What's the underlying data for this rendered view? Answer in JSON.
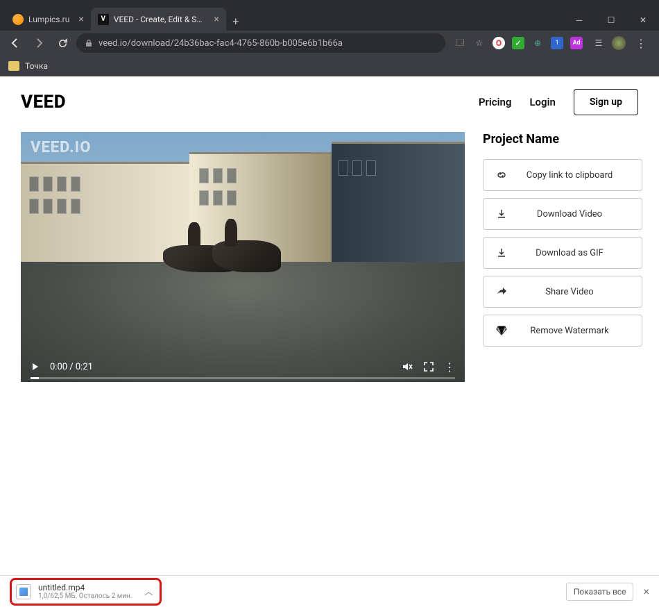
{
  "window": {
    "tabs": [
      {
        "title": "Lumpics.ru"
      },
      {
        "title": "VEED - Create, Edit & Share Vide"
      }
    ]
  },
  "addressbar": {
    "url": "veed.io/download/24b36bac-fac4-4765-860b-b005e6b1b66a"
  },
  "bookmarks": {
    "item0": "Точка"
  },
  "page": {
    "logo": "VEED",
    "nav": {
      "pricing": "Pricing",
      "login": "Login",
      "signup": "Sign up"
    },
    "watermark": "VEED.IO",
    "video": {
      "time": "0:00 / 0:21"
    },
    "side": {
      "heading": "Project Name",
      "copy_link": "Copy link to clipboard",
      "download_video": "Download Video",
      "download_gif": "Download as GIF",
      "share": "Share Video",
      "remove_wm": "Remove Watermark"
    }
  },
  "download": {
    "filename": "untitled.mp4",
    "meta": "1,0/62,5 МБ. Осталось 2 мин.",
    "show_all": "Показать все"
  }
}
